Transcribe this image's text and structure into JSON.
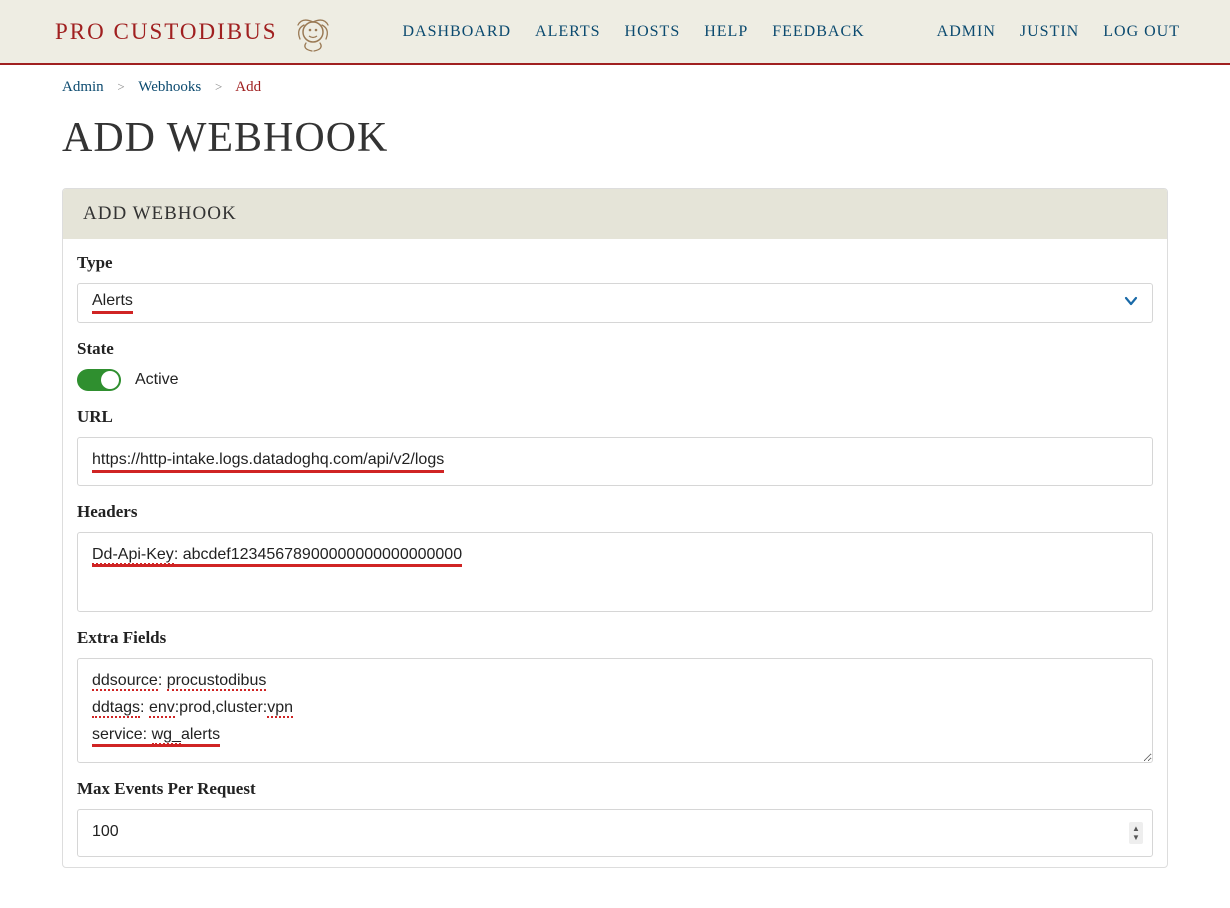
{
  "brand": "PRO CUSTODIBUS",
  "nav1": {
    "dashboard": "DASHBOARD",
    "alerts": "ALERTS",
    "hosts": "HOSTS",
    "help": "HELP",
    "feedback": "FEEDBACK"
  },
  "nav2": {
    "admin": "ADMIN",
    "user": "JUSTIN",
    "logout": "LOG OUT"
  },
  "breadcrumbs": {
    "admin": "Admin",
    "webhooks": "Webhooks",
    "add": "Add"
  },
  "page_title": "ADD WEBHOOK",
  "panel_title": "ADD WEBHOOK",
  "form": {
    "type": {
      "label": "Type",
      "value": "Alerts"
    },
    "state": {
      "label": "State",
      "status": "Active"
    },
    "url": {
      "label": "URL",
      "value": "https://http-intake.logs.datadoghq.com/api/v2/logs"
    },
    "headers": {
      "label": "Headers",
      "key": "Dd-Api-Key",
      "rest": ": abcdef12345678900000000000000000"
    },
    "extra": {
      "label": "Extra Fields",
      "l1a": "ddsource",
      "l1b": ": ",
      "l1c": "procustodibus",
      "l2a": "ddtags",
      "l2b": ": ",
      "l2c": "env",
      "l2d": ":prod,cluster:",
      "l2e": "vpn",
      "l3a": "service: ",
      "l3b": "wg_",
      "l3c": "alerts"
    },
    "max_events": {
      "label": "Max Events Per Request",
      "value": "100"
    }
  }
}
